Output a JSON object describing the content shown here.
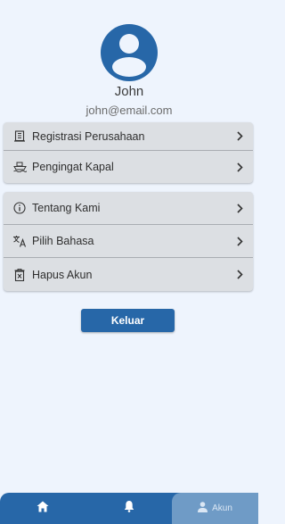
{
  "profile": {
    "name": "John",
    "email": "john@email.com",
    "avatar_icon": "user-avatar-icon"
  },
  "menu_group_1": [
    {
      "label": "Registrasi Perusahaan",
      "icon": "building-icon"
    },
    {
      "label": "Pengingat Kapal",
      "icon": "ship-icon"
    }
  ],
  "menu_group_2": [
    {
      "label": "Tentang Kami",
      "icon": "info-icon"
    },
    {
      "label": "Pilih Bahasa",
      "icon": "translate-icon"
    },
    {
      "label": "Hapus Akun",
      "icon": "delete-icon"
    }
  ],
  "logout_label": "Keluar",
  "nav": {
    "home_icon": "home-icon",
    "notification_icon": "bell-icon",
    "account_label": "Akun",
    "account_icon": "person-icon"
  },
  "colors": {
    "primary": "#2767a8",
    "background": "#eef4fd",
    "card": "#dcdfe3",
    "nav_active": "#6f9bc6"
  }
}
